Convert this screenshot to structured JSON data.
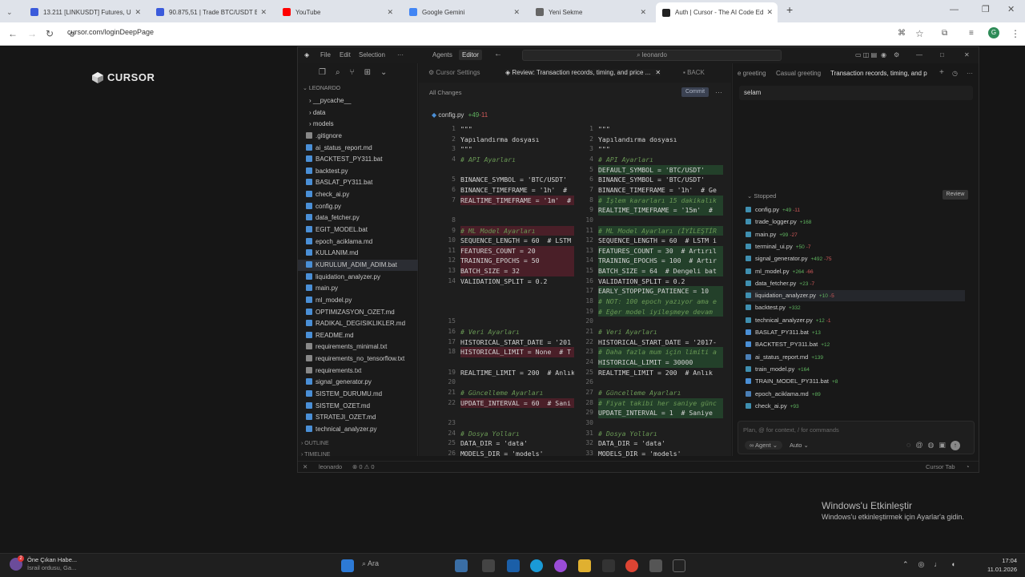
{
  "browser": {
    "tabs": [
      {
        "label": "13.211 [LINKUSDT] Futures, US...",
        "icon": "app-icon",
        "color": "#3b5bdb"
      },
      {
        "label": "90.875,51 | Trade BTC/USDT Bi...",
        "icon": "app-icon",
        "color": "#3b5bdb"
      },
      {
        "label": "YouTube",
        "icon": "youtube-icon",
        "color": "#ff0000"
      },
      {
        "label": "Google Gemini",
        "icon": "gemini-icon",
        "color": "#4285f4"
      },
      {
        "label": "Yeni Sekme",
        "icon": "globe-icon",
        "color": "#666"
      },
      {
        "label": "Auth | Cursor - The AI Code Edi...",
        "icon": "cursor-icon",
        "color": "#222"
      }
    ],
    "url": "cursor.com/loginDeepPage",
    "profile_initial": "G"
  },
  "page": {
    "logo": "CURSOR"
  },
  "editor": {
    "menu": [
      "File",
      "Edit",
      "Selection",
      "···"
    ],
    "mode_tabs": [
      "Agents",
      "Editor"
    ],
    "search": "leonardo",
    "explorer": {
      "root": "LEONARDO",
      "items": [
        {
          "name": "__pycache__",
          "type": "folder"
        },
        {
          "name": "data",
          "type": "folder"
        },
        {
          "name": "models",
          "type": "folder"
        },
        {
          "name": ".gitignore",
          "type": "file",
          "color": "#888"
        },
        {
          "name": "ai_status_report.md",
          "type": "file",
          "color": "#4a8fd6"
        },
        {
          "name": "BACKTEST_PY311.bat",
          "type": "file",
          "color": "#4a8fd6"
        },
        {
          "name": "backtest.py",
          "type": "file",
          "color": "#4a8fd6"
        },
        {
          "name": "BASLAT_PY311.bat",
          "type": "file",
          "color": "#4a8fd6"
        },
        {
          "name": "check_ai.py",
          "type": "file",
          "color": "#4a8fd6"
        },
        {
          "name": "config.py",
          "type": "file",
          "color": "#4a8fd6"
        },
        {
          "name": "data_fetcher.py",
          "type": "file",
          "color": "#4a8fd6"
        },
        {
          "name": "EGIT_MODEL.bat",
          "type": "file",
          "color": "#4a8fd6"
        },
        {
          "name": "epoch_aciklama.md",
          "type": "file",
          "color": "#4a8fd6"
        },
        {
          "name": "KULLANIM.md",
          "type": "file",
          "color": "#4a8fd6"
        },
        {
          "name": "KURULUM_ADIM_ADIM.bat",
          "type": "file",
          "color": "#4a8fd6"
        },
        {
          "name": "liquidation_analyzer.py",
          "type": "file",
          "color": "#4a8fd6"
        },
        {
          "name": "main.py",
          "type": "file",
          "color": "#4a8fd6"
        },
        {
          "name": "ml_model.py",
          "type": "file",
          "color": "#4a8fd6"
        },
        {
          "name": "OPTIMIZASYON_OZET.md",
          "type": "file",
          "color": "#4a8fd6"
        },
        {
          "name": "RADIKAL_DEGISIKLIKLER.md",
          "type": "file",
          "color": "#4a8fd6"
        },
        {
          "name": "README.md",
          "type": "file",
          "color": "#4a8fd6"
        },
        {
          "name": "requirements_minimal.txt",
          "type": "file",
          "color": "#888"
        },
        {
          "name": "requirements_no_tensorflow.txt",
          "type": "file",
          "color": "#888"
        },
        {
          "name": "requirements.txt",
          "type": "file",
          "color": "#888"
        },
        {
          "name": "signal_generator.py",
          "type": "file",
          "color": "#4a8fd6"
        },
        {
          "name": "SISTEM_DURUMU.md",
          "type": "file",
          "color": "#4a8fd6"
        },
        {
          "name": "SISTEM_OZET.md",
          "type": "file",
          "color": "#4a8fd6"
        },
        {
          "name": "STRATEJI_OZET.md",
          "type": "file",
          "color": "#4a8fd6"
        },
        {
          "name": "technical_analyzer.py",
          "type": "file",
          "color": "#4a8fd6"
        }
      ],
      "outline": "OUTLINE",
      "timeline": "TIMELINE"
    },
    "diff": {
      "tabs": [
        "Cursor Settings",
        "Review: Transaction records, timing, and price ...",
        "BACK"
      ],
      "all_changes": "All Changes",
      "commit": "Commit",
      "file": "config.py",
      "file_add": "+49",
      "file_del": "-11",
      "left": [
        {
          "n": "1",
          "t": "\"\"\"",
          "k": ""
        },
        {
          "n": "2",
          "t": "Yapılandırma dosyası",
          "k": ""
        },
        {
          "n": "3",
          "t": "\"\"\"",
          "k": ""
        },
        {
          "n": "4",
          "t": "# API Ayarları",
          "k": "cm"
        },
        {
          "n": "",
          "t": "",
          "k": ""
        },
        {
          "n": "5",
          "t": "BINANCE_SYMBOL = 'BTC/USDT'",
          "k": ""
        },
        {
          "n": "6",
          "t": "BINANCE_TIMEFRAME = '1h'  # ",
          "k": ""
        },
        {
          "n": "7",
          "t": "REALTIME_TIMEFRAME = '1m'  #",
          "k": "del"
        },
        {
          "n": "",
          "t": "",
          "k": ""
        },
        {
          "n": "8",
          "t": "",
          "k": ""
        },
        {
          "n": "9",
          "t": "# ML Model Ayarları",
          "k": "del cm"
        },
        {
          "n": "10",
          "t": "SEQUENCE_LENGTH = 60  # LSTM",
          "k": ""
        },
        {
          "n": "11",
          "t": "FEATURES_COUNT = 20",
          "k": "del"
        },
        {
          "n": "12",
          "t": "TRAINING_EPOCHS = 50",
          "k": "del"
        },
        {
          "n": "13",
          "t": "BATCH_SIZE = 32",
          "k": "del"
        },
        {
          "n": "14",
          "t": "VALIDATION_SPLIT = 0.2",
          "k": ""
        },
        {
          "n": "",
          "t": "",
          "k": ""
        },
        {
          "n": "",
          "t": "",
          "k": ""
        },
        {
          "n": "",
          "t": "",
          "k": ""
        },
        {
          "n": "15",
          "t": "",
          "k": ""
        },
        {
          "n": "16",
          "t": "# Veri Ayarları",
          "k": "cm"
        },
        {
          "n": "17",
          "t": "HISTORICAL_START_DATE = '201",
          "k": ""
        },
        {
          "n": "18",
          "t": "HISTORICAL_LIMIT = None  # T",
          "k": "del"
        },
        {
          "n": "",
          "t": "",
          "k": ""
        },
        {
          "n": "19",
          "t": "REALTIME_LIMIT = 200  # Anlık",
          "k": ""
        },
        {
          "n": "20",
          "t": "",
          "k": ""
        },
        {
          "n": "21",
          "t": "# Güncelleme Ayarları",
          "k": "cm"
        },
        {
          "n": "22",
          "t": "UPDATE_INTERVAL = 60  # Sani",
          "k": "del"
        },
        {
          "n": "",
          "t": "",
          "k": ""
        },
        {
          "n": "23",
          "t": "",
          "k": ""
        },
        {
          "n": "24",
          "t": "# Dosya Yolları",
          "k": "cm"
        },
        {
          "n": "25",
          "t": "DATA_DIR = 'data'",
          "k": ""
        },
        {
          "n": "26",
          "t": "MODELS_DIR = 'models'",
          "k": ""
        }
      ],
      "right": [
        {
          "n": "1",
          "t": "\"\"\"",
          "k": ""
        },
        {
          "n": "2",
          "t": "Yapılandırma dosyası",
          "k": ""
        },
        {
          "n": "3",
          "t": "\"\"\"",
          "k": ""
        },
        {
          "n": "4",
          "t": "# API Ayarları",
          "k": "cm"
        },
        {
          "n": "5",
          "t": "DEFAULT_SYMBOL = 'BTC/USDT'",
          "k": "add"
        },
        {
          "n": "6",
          "t": "BINANCE_SYMBOL = 'BTC/USDT'",
          "k": ""
        },
        {
          "n": "7",
          "t": "BINANCE_TIMEFRAME = '1h'  # Ge",
          "k": ""
        },
        {
          "n": "8",
          "t": "# İşlem kararları 15 dakikalık",
          "k": "add cm"
        },
        {
          "n": "9",
          "t": "REALTIME_TIMEFRAME = '15m'  #",
          "k": "add"
        },
        {
          "n": "10",
          "t": "",
          "k": ""
        },
        {
          "n": "11",
          "t": "# ML Model Ayarları (İYİLEŞTİR",
          "k": "add cm"
        },
        {
          "n": "12",
          "t": "SEQUENCE_LENGTH = 60  # LSTM i",
          "k": ""
        },
        {
          "n": "13",
          "t": "FEATURES_COUNT = 30  # Artırıl",
          "k": "add"
        },
        {
          "n": "14",
          "t": "TRAINING_EPOCHS = 100  # Artır",
          "k": "add"
        },
        {
          "n": "15",
          "t": "BATCH_SIZE = 64  # Dengeli bat",
          "k": "add"
        },
        {
          "n": "16",
          "t": "VALIDATION_SPLIT = 0.2",
          "k": ""
        },
        {
          "n": "17",
          "t": "EARLY_STOPPING_PATIENCE = 10",
          "k": "add"
        },
        {
          "n": "18",
          "t": "# NOT: 100 epoch yazıyor ama e",
          "k": "add cm"
        },
        {
          "n": "19",
          "t": "# Eğer model iyileşmeye devam",
          "k": "add cm"
        },
        {
          "n": "20",
          "t": "",
          "k": ""
        },
        {
          "n": "21",
          "t": "# Veri Ayarları",
          "k": "cm"
        },
        {
          "n": "22",
          "t": "HISTORICAL_START_DATE = '2017-",
          "k": ""
        },
        {
          "n": "23",
          "t": "# Daha fazla mum için limiti a",
          "k": "add cm"
        },
        {
          "n": "24",
          "t": "HISTORICAL_LIMIT = 30000",
          "k": "add"
        },
        {
          "n": "25",
          "t": "REALTIME_LIMIT = 200  # Anlık",
          "k": ""
        },
        {
          "n": "26",
          "t": "",
          "k": ""
        },
        {
          "n": "27",
          "t": "# Güncelleme Ayarları",
          "k": "cm"
        },
        {
          "n": "28",
          "t": "# Fiyat takibi her saniye günc",
          "k": "add cm"
        },
        {
          "n": "29",
          "t": "UPDATE_INTERVAL = 1  # Saniye",
          "k": "add"
        },
        {
          "n": "30",
          "t": "",
          "k": ""
        },
        {
          "n": "31",
          "t": "# Dosya Yolları",
          "k": "cm"
        },
        {
          "n": "32",
          "t": "DATA_DIR = 'data'",
          "k": ""
        },
        {
          "n": "33",
          "t": "MODELS_DIR = 'models'",
          "k": ""
        }
      ]
    },
    "chat": {
      "tabs": [
        "e greeting",
        "Casual greeting",
        "Transaction records, timing, and p"
      ],
      "message": "selam",
      "stopped": "Stopped",
      "review": "Review",
      "files": [
        {
          "name": "config.py",
          "add": "+49",
          "del": "-11"
        },
        {
          "name": "trade_logger.py",
          "add": "+168",
          "del": ""
        },
        {
          "name": "main.py",
          "add": "+99",
          "del": "-27"
        },
        {
          "name": "terminal_ui.py",
          "add": "+50",
          "del": "-7"
        },
        {
          "name": "signal_generator.py",
          "add": "+492",
          "del": "-75"
        },
        {
          "name": "ml_model.py",
          "add": "+264",
          "del": "-66"
        },
        {
          "name": "data_fetcher.py",
          "add": "+23",
          "del": "-7"
        },
        {
          "name": "liquidation_analyzer.py",
          "add": "+10",
          "del": "-5"
        },
        {
          "name": "backtest.py",
          "add": "+332",
          "del": ""
        },
        {
          "name": "technical_analyzer.py",
          "add": "+12",
          "del": "-1"
        },
        {
          "name": "BASLAT_PY311.bat",
          "add": "+13",
          "del": ""
        },
        {
          "name": "BACKTEST_PY311.bat",
          "add": "+12",
          "del": ""
        },
        {
          "name": "ai_status_report.md",
          "add": "+139",
          "del": ""
        },
        {
          "name": "train_model.py",
          "add": "+164",
          "del": ""
        },
        {
          "name": "TRAIN_MODEL_PY311.bat",
          "add": "+8",
          "del": ""
        },
        {
          "name": "epoch_aciklama.md",
          "add": "+89",
          "del": ""
        },
        {
          "name": "check_ai.py",
          "add": "+93",
          "del": ""
        }
      ],
      "input_placeholder": "Plan, @ for context, / for commands",
      "agent": "∞ Agent ⌄",
      "auto": "Auto ⌄"
    },
    "status": {
      "branch": "leonardo",
      "problems": "⊗ 0 ⚠ 0",
      "right": "Cursor Tab"
    }
  },
  "activate": {
    "title": "Windows'u Etkinleştir",
    "subtitle": "Windows'u etkinleştirmek için Ayarlar'a gidin."
  },
  "taskbar": {
    "news_title": "Öne Çıkan Habe...",
    "news_sub": "İsrail ordusu, Ga...",
    "news_badge": "2",
    "search": "Ara",
    "time": "17:04",
    "date": "11.01.2026"
  }
}
